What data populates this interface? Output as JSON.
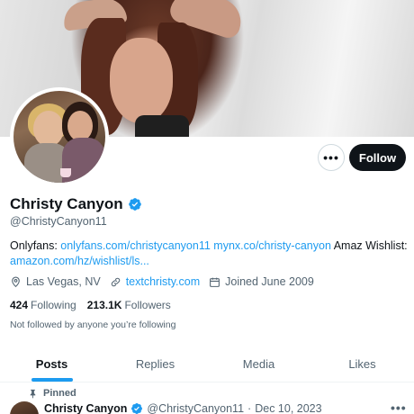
{
  "profile": {
    "name": "Christy Canyon",
    "handle": "@ChristyCanyon11",
    "follow_label": "Follow",
    "more_label": "•••",
    "bio": {
      "prefix": "Onlyfans: ",
      "link1": "onlyfans.com/christycanyon11",
      "space": " ",
      "link2": "mynx.co/christy-canyon",
      "mid": " Amaz Wishlist: ",
      "link3": "amazon.com/hz/wishlist/ls..."
    },
    "location": "Las Vegas, NV",
    "website": "textchristy.com",
    "joined": "Joined June 2009",
    "following_count": "424",
    "following_label": "Following",
    "followers_count": "213.1K",
    "followers_label": "Followers",
    "not_followed": "Not followed by anyone you’re following"
  },
  "tabs": [
    {
      "label": "Posts",
      "active": true
    },
    {
      "label": "Replies",
      "active": false
    },
    {
      "label": "Media",
      "active": false
    },
    {
      "label": "Likes",
      "active": false
    }
  ],
  "post": {
    "pinned_label": "Pinned",
    "author_name": "Christy Canyon",
    "author_handle": "@ChristyCanyon11",
    "separator": "·",
    "date": "Dec 10, 2023",
    "more_label": "•••"
  },
  "colors": {
    "accent": "#1d9bf0",
    "text": "#0f1419",
    "muted": "#536471"
  },
  "icons": {
    "verified": "verified-badge-icon",
    "location": "location-pin-icon",
    "website": "link-icon",
    "joined": "calendar-icon",
    "pinned": "pin-icon"
  }
}
